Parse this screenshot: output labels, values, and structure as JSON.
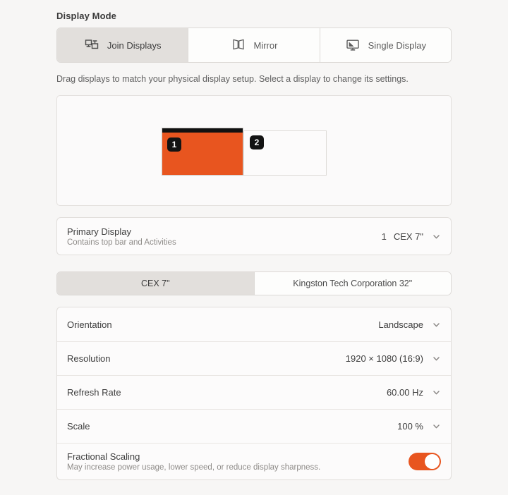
{
  "section": {
    "title": "Display Mode",
    "hint": "Drag displays to match your physical display setup. Select a display to change its settings."
  },
  "display_mode": {
    "options": [
      {
        "label": "Join Displays",
        "icon": "join-displays-icon",
        "selected": true
      },
      {
        "label": "Mirror",
        "icon": "mirror-icon",
        "selected": false
      },
      {
        "label": "Single Display",
        "icon": "single-display-icon",
        "selected": false
      }
    ]
  },
  "arrangement": {
    "monitors": [
      {
        "badge": "1",
        "selected": true,
        "has_top_bar": true,
        "color": "#e8551f"
      },
      {
        "badge": "2",
        "selected": false,
        "has_top_bar": false,
        "color": "#fcfbfb"
      }
    ]
  },
  "primary_display": {
    "title": "Primary Display",
    "subtitle": "Contains top bar and Activities",
    "index": "1",
    "value": "CEX 7\""
  },
  "display_tabs": [
    {
      "label": "CEX 7\"",
      "selected": true
    },
    {
      "label": "Kingston Tech Corporation 32\"",
      "selected": false
    }
  ],
  "settings": {
    "orientation": {
      "title": "Orientation",
      "value": "Landscape"
    },
    "resolution": {
      "title": "Resolution",
      "value": "1920 × 1080 (16:9)"
    },
    "refresh_rate": {
      "title": "Refresh Rate",
      "value": "60.00 Hz"
    },
    "scale": {
      "title": "Scale",
      "value": "100 %"
    },
    "fractional_scaling": {
      "title": "Fractional Scaling",
      "subtitle": "May increase power usage, lower speed, or reduce display sharpness.",
      "enabled": true
    }
  },
  "colors": {
    "accent": "#e8551f",
    "background": "#f7f6f5",
    "card": "#fcfbfb",
    "selected_segment": "#e2dfdc"
  }
}
